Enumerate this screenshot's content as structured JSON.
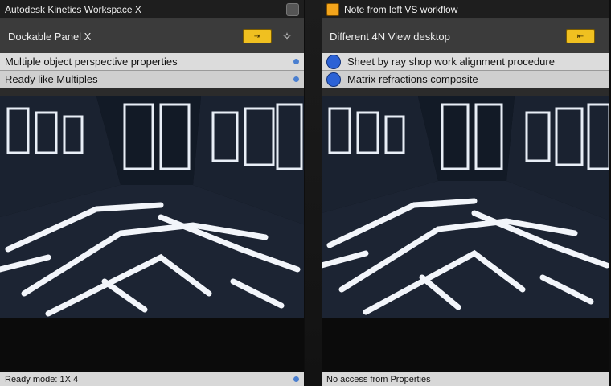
{
  "left": {
    "title": "Autodesk Kinetics Workspace X",
    "toolbar_text": "Dockable Panel X",
    "toolbar_button": "⇥",
    "rows": [
      "Multiple object perspective properties",
      "Ready like Multiples"
    ],
    "status": "Ready mode: 1X 4"
  },
  "right": {
    "title": "Note from left VS workflow",
    "toolbar_text": "Different 4N View desktop",
    "toolbar_button": "⇤",
    "rows": [
      "Sheet by ray shop work alignment procedure",
      "Matrix refractions composite"
    ],
    "status": "No access from Properties"
  },
  "icons": {
    "app": "app-icon",
    "wand": "wand-icon",
    "globe": "globe-icon"
  },
  "colors": {
    "accent_yellow": "#f0c020",
    "accent_blue": "#2c62d6"
  }
}
